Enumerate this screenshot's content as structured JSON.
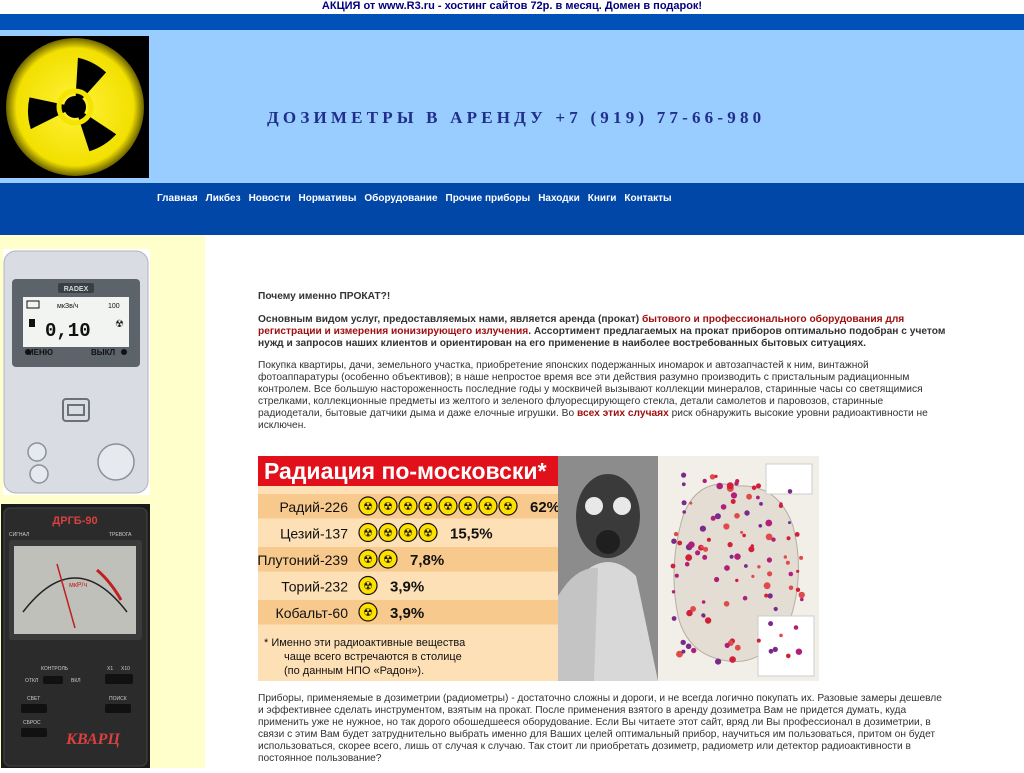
{
  "promo": {
    "text": "АКЦИЯ от www.R3.ru - хостинг сайтов 72р. в месяц. Домен в подарок!"
  },
  "header": {
    "title": "ДОЗИМЕТРЫ В АРЕНДУ +7 (919) 77-66-980"
  },
  "nav": [
    "Главная",
    "Ликбез",
    "Новости",
    "Нормативы",
    "Оборудование",
    "Прочие приборы",
    "Находки",
    "Книги",
    "Контакты"
  ],
  "sidebar": {
    "radex": {
      "brand": "RADEX",
      "units": "мкЗв/ч",
      "reading": "0,10",
      "range": "100",
      "menu": "МЕНЮ",
      "off": "ВЫКЛ"
    },
    "kvarc": {
      "model": "ДРГБ-90",
      "signal": "СИГНАЛ",
      "alarm": "ТРЕВОГА",
      "unit": "мкР/ч",
      "control": "КОНТРОЛЬ",
      "x1": "X1",
      "x10": "X10",
      "off": "ОТКЛ",
      "on": "ВКЛ",
      "light": "СВЕТ",
      "search": "ПОИСК",
      "reset": "СБРОС",
      "brand": "КВАРЦ"
    }
  },
  "content": {
    "question": "Почему именно ПРОКАТ?!",
    "p1_start": "Основным видом услуг, предоставляемых нами, является аренда (прокат) ",
    "p1_highlight": "бытового и профессионального оборудования для регистрации и измерения ионизирующего излучения",
    "p1_end": ". Ассортимент предлагаемых на прокат приборов оптимально подобран с учетом нужд и запросов наших клиентов и ориентирован на его применение в наиболее востребованных бытовых ситуациях.",
    "p2_start": "Покупка квартиры, дачи, земельного участка, приобретение японских подержанных иномарок и автозапчастей к ним, винтажной фотоаппаратуры (особенно объективов); в наше непростое время все эти действия разумно производить с пристальным радиационным контролем. Все большую настороженность последние годы у москвичей вызывают коллекции минералов, старинные часы со светящимися стрелками, коллекционные предметы из желтого и зеленого флуоресцирующего стекла, детали самолетов и паровозов, старинные радиодетали, бытовые датчики дыма и даже елочные игрушки. Во ",
    "p2_link": "всех этих случаях",
    "p2_end": " риск обнаружить высокие уровни радиоактивности не исключен.",
    "p3": "Приборы, применяемые в дозиметрии (радиометры) - достаточно сложны и дороги, и не всегда логично покупать их. Разовые замеры дешевле и эффективнее сделать инструментом, взятым на прокат. После применения взятого в аренду дозиметра Вам не придется думать, куда применить уже не нужное, но так дорого обошедшееся оборудование. Если Вы читаете этот сайт, вряд ли Вы профессионал в дозиметрии, в связи с этим Вам будет затруднительно выбрать именно для Ваших целей оптимальный прибор, научиться им пользоваться, притом он будет использоваться, скорее всего, лишь от случая к случаю. Так стоит ли приобретать дозиметр, радиометр или детектор радиоактивности в постоянное пользование?"
  },
  "infographic": {
    "title": "Радиация по-московски*",
    "footnote_1": "* Именно эти радиоактивные вещества",
    "footnote_2": "чаще всего встречаются в столице",
    "footnote_3": "(по данным НПО «Радон»).",
    "colors": {
      "title_bg": "#e2101b",
      "panel": "#fde0b6",
      "row_alt": "#f7c98c",
      "yellow": "#ffe100"
    }
  },
  "chart_data": {
    "type": "bar",
    "title": "Радиация по-московски*",
    "categories": [
      "Радий-226",
      "Цезий-137",
      "Плутоний-239",
      "Торий-232",
      "Кобальт-60"
    ],
    "values": [
      62,
      15.5,
      7.8,
      3.9,
      3.9
    ],
    "value_labels": [
      "62%",
      "15,5%",
      "7,8%",
      "3,9%",
      "3,9%"
    ],
    "icons_per_row": [
      8,
      4,
      2,
      1,
      1
    ],
    "xlabel": "",
    "ylabel": ""
  }
}
